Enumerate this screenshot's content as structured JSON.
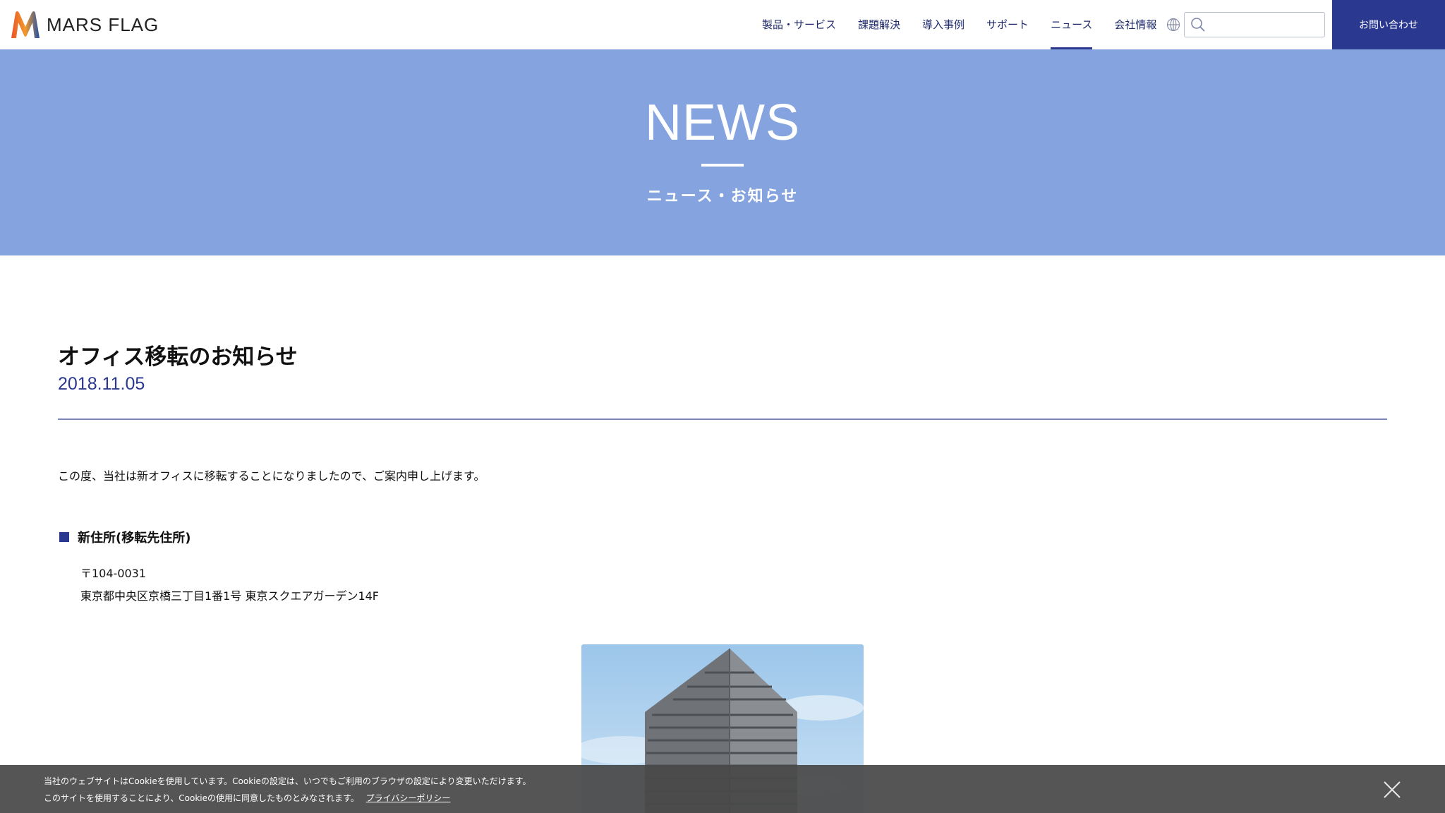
{
  "header": {
    "logo_text": "MARS FLAG",
    "nav": [
      {
        "label": "製品・サービス"
      },
      {
        "label": "課題解決"
      },
      {
        "label": "導入事例"
      },
      {
        "label": "サポート"
      },
      {
        "label": "ニュース",
        "active": true
      },
      {
        "label": "会社情報"
      }
    ],
    "search_placeholder": "",
    "contact_label": "お問い合わせ"
  },
  "hero": {
    "title": "NEWS",
    "subtitle": "ニュース・お知らせ"
  },
  "article": {
    "title": "オフィス移転のお知らせ",
    "date": "2018.11.05",
    "intro": "この度、当社は新オフィスに移転することになりましたので、ご案内申し上げます。",
    "section_heading": "新住所(移転先住所)",
    "postal": "〒104-0031",
    "address": "東京都中央区京橋三丁目1番1号 東京スクエアガーデン14F"
  },
  "cookie": {
    "line1": "当社のウェブサイトはCookieを使用しています。Cookieの設定は、いつでもご利用のブラウザの設定により変更いただけます。",
    "line2": "このサイトを使用することにより、Cookieの使用に同意したものとみなされます。",
    "link": "プライバシーポリシー"
  },
  "colors": {
    "brand_navy": "#2a3890",
    "hero_blue": "#84a3df",
    "cookie_bg": "#484848"
  },
  "icons": [
    "mars-flag-logo-icon",
    "globe-icon",
    "search-icon",
    "square-bullet-icon",
    "close-icon"
  ]
}
